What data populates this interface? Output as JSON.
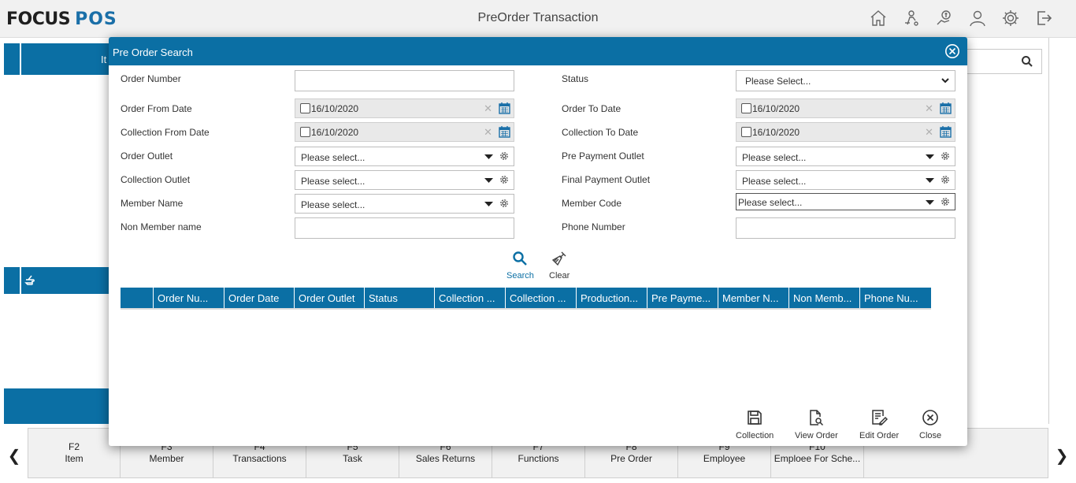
{
  "app": {
    "logo_left": "FOCUS",
    "logo_right": "POS",
    "title": "PreOrder Transaction"
  },
  "header_icons": [
    "home-icon",
    "delivery-icon",
    "money-icon",
    "user-icon",
    "settings-icon",
    "logout-icon"
  ],
  "background": {
    "column_fragment": "It"
  },
  "modal": {
    "title": "Pre Order Search",
    "fields": {
      "order_number_label": "Order Number",
      "status_label": "Status",
      "status_value": "Please Select...",
      "order_from_date_label": "Order From Date",
      "order_from_date_value": "16/10/2020",
      "order_to_date_label": "Order To Date",
      "order_to_date_value": "16/10/2020",
      "collection_from_date_label": "Collection From Date",
      "collection_from_date_value": "16/10/2020",
      "collection_to_date_label": "Collection To Date",
      "collection_to_date_value": "16/10/2020",
      "order_outlet_label": "Order Outlet",
      "order_outlet_value": "Please select...",
      "pre_payment_outlet_label": "Pre Payment Outlet",
      "pre_payment_outlet_value": "Please select...",
      "collection_outlet_label": "Collection Outlet",
      "collection_outlet_value": "Please select...",
      "final_payment_outlet_label": "Final Payment Outlet",
      "final_payment_outlet_value": "Please select...",
      "member_name_label": "Member Name",
      "member_name_value": "Please select...",
      "member_code_label": "Member Code",
      "member_code_value": "Please select...",
      "non_member_name_label": "Non Member name",
      "phone_number_label": "Phone Number"
    },
    "actions": {
      "search": "Search",
      "clear": "Clear"
    },
    "grid_columns": [
      "",
      "Order Nu...",
      "Order Date",
      "Order Outlet",
      "Status",
      "Collection ...",
      "Collection ...",
      "Production...",
      "Pre Payme...",
      "Member N...",
      "Non Memb...",
      "Phone Nu..."
    ],
    "footer_actions": {
      "collection": "Collection",
      "view_order": "View Order",
      "edit_order": "Edit Order",
      "close": "Close"
    }
  },
  "function_keys": [
    {
      "key": "F2",
      "label": "Item"
    },
    {
      "key": "F3",
      "label": "Member"
    },
    {
      "key": "F4",
      "label": "Transactions"
    },
    {
      "key": "F5",
      "label": "Task"
    },
    {
      "key": "F6",
      "label": "Sales Returns"
    },
    {
      "key": "F7",
      "label": "Functions"
    },
    {
      "key": "F8",
      "label": "Pre Order"
    },
    {
      "key": "F9",
      "label": "Employee"
    },
    {
      "key": "F10",
      "label": "Emploee For Sche..."
    }
  ],
  "colors": {
    "primary": "#0b6fa4",
    "header_bg": "#f1f1f1"
  }
}
